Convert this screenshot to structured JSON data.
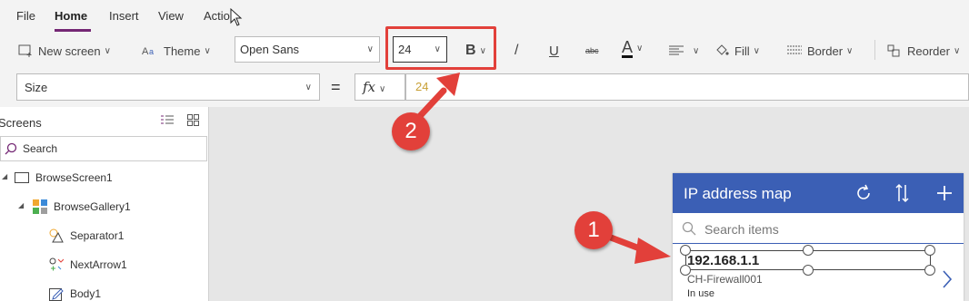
{
  "menu": {
    "items": [
      {
        "label": "File"
      },
      {
        "label": "Home",
        "active": true
      },
      {
        "label": "Insert"
      },
      {
        "label": "View"
      },
      {
        "label": "Action"
      }
    ]
  },
  "ribbon": {
    "new_screen_label": "New screen",
    "theme_label": "Theme",
    "font_value": "Open Sans",
    "font_size_value": "24",
    "bold_label": "B",
    "italic_label": "/",
    "underline_label": "U",
    "strikethrough_label": "abc",
    "font_color_label": "A",
    "fill_label": "Fill",
    "border_label": "Border",
    "reorder_label": "Reorder"
  },
  "formula": {
    "property_value": "Size",
    "equals": "=",
    "fx_label": "fx",
    "formula_value": "24"
  },
  "tree": {
    "title": "Screens",
    "search_placeholder": "Search",
    "items": [
      {
        "label": "BrowseScreen1",
        "icon": "screen-icon"
      },
      {
        "label": "BrowseGallery1",
        "icon": "gallery-icon"
      },
      {
        "label": "Separator1",
        "icon": "shapes-icon"
      },
      {
        "label": "NextArrow1",
        "icon": "arrow-control-icon"
      },
      {
        "label": "Body1",
        "icon": "edit-text-icon"
      }
    ]
  },
  "app": {
    "title": "IP address map",
    "search_placeholder": "Search items",
    "item": {
      "title": "192.168.1.1",
      "subtitle": "CH-Firewall001",
      "body": "In use"
    }
  },
  "callouts": {
    "one": "1",
    "two": "2"
  },
  "colors": {
    "accent": "#742774",
    "app_header": "#3b5fb5",
    "callout": "#e2403a",
    "formula_value": "#c8a036"
  }
}
